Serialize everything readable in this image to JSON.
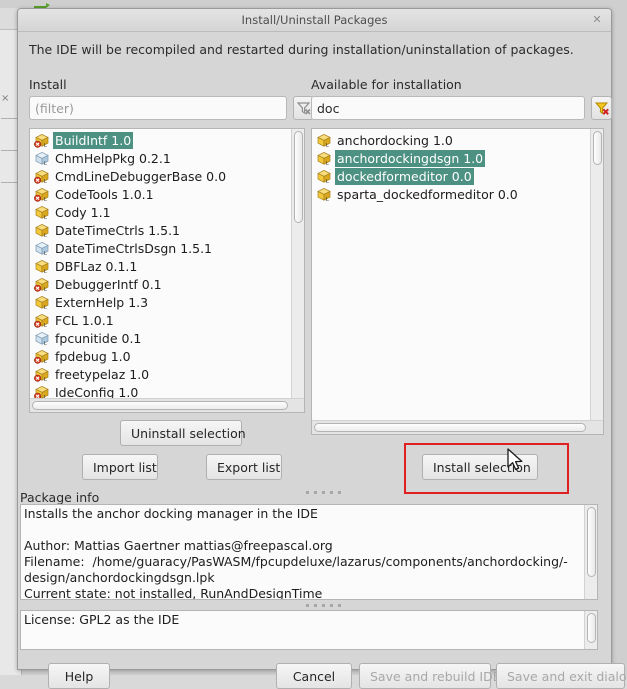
{
  "window": {
    "title": "Install/Uninstall Packages",
    "close_icon": "close-icon",
    "close_glyph": "✕"
  },
  "intro_text": "The IDE will be recompiled and restarted during installation/uninstallation of packages.",
  "install_panel": {
    "label": "Install",
    "filter": {
      "value": "",
      "placeholder": "(filter)",
      "clear_icon": "filter-clear-icon",
      "enabled": false
    },
    "packages": [
      {
        "name": "BuildIntf 1.0",
        "icon": "package-installed-icon",
        "selected": true
      },
      {
        "name": "ChmHelpPkg 0.2.1",
        "icon": "package-design-icon",
        "selected": false
      },
      {
        "name": "CmdLineDebuggerBase 0.0",
        "icon": "package-installed-icon",
        "selected": false
      },
      {
        "name": "CodeTools 1.0.1",
        "icon": "package-installed-icon",
        "selected": false
      },
      {
        "name": "Cody 1.1",
        "icon": "package-icon",
        "selected": false
      },
      {
        "name": "DateTimeCtrls 1.5.1",
        "icon": "package-icon",
        "selected": false
      },
      {
        "name": "DateTimeCtrlsDsgn 1.5.1",
        "icon": "package-design-icon",
        "selected": false
      },
      {
        "name": "DBFLaz 0.1.1",
        "icon": "package-icon",
        "selected": false
      },
      {
        "name": "DebuggerIntf 0.1",
        "icon": "package-installed-icon",
        "selected": false
      },
      {
        "name": "ExternHelp 1.3",
        "icon": "package-icon",
        "selected": false
      },
      {
        "name": "FCL 1.0.1",
        "icon": "package-installed-icon",
        "selected": false
      },
      {
        "name": "fpcunitide 0.1",
        "icon": "package-design-icon",
        "selected": false
      },
      {
        "name": "fpdebug 1.0",
        "icon": "package-installed-icon",
        "selected": false
      },
      {
        "name": "freetypelaz 1.0",
        "icon": "package-installed-icon",
        "selected": false
      },
      {
        "name": "IdeConfig 1.0",
        "icon": "package-installed-icon",
        "selected": false
      }
    ]
  },
  "available_panel": {
    "label": "Available for installation",
    "filter": {
      "value": "doc",
      "placeholder": "",
      "clear_icon": "filter-clear-icon",
      "enabled": true
    },
    "packages": [
      {
        "name": "anchordocking 1.0",
        "icon": "package-icon",
        "selected": false
      },
      {
        "name": "anchordockingdsgn 1.0",
        "icon": "package-icon",
        "selected": true
      },
      {
        "name": "dockedformeditor 0.0",
        "icon": "package-icon",
        "selected": true
      },
      {
        "name": "sparta_dockedformeditor 0.0",
        "icon": "package-icon",
        "selected": false
      }
    ]
  },
  "actions": {
    "uninstall_selection": "Uninstall selection",
    "import_list": "Import list",
    "export_list": "Export list",
    "install_selection": "Install selection"
  },
  "package_info": {
    "label": "Package info",
    "lines": [
      "Installs the anchor docking manager in the IDE",
      "",
      "Author: Mattias Gaertner mattias@freepascal.org",
      "Filename:  /home/guaracy/PasWASM/fpcupdeluxe/lazarus/components/anchordocking/-",
      "design/anchordockingdsgn.lpk",
      "Current state: not installed, RunAndDesignTime"
    ]
  },
  "license_info": {
    "lines": [
      "License: GPL2 as the IDE"
    ]
  },
  "footer": {
    "help": "Help",
    "cancel": "Cancel",
    "save_and_rebuild": "Save and rebuild IDE",
    "save_and_exit": "Save and exit dialog",
    "save_and_rebuild_enabled": false,
    "save_and_exit_enabled": false
  },
  "annotation": {
    "highlight_target": "install-selection-button",
    "highlight_color": "#e02020"
  },
  "colors": {
    "selection": "#4c9182",
    "dialog_bg": "#d6d6d6",
    "field_bg": "#fbfbfb"
  }
}
